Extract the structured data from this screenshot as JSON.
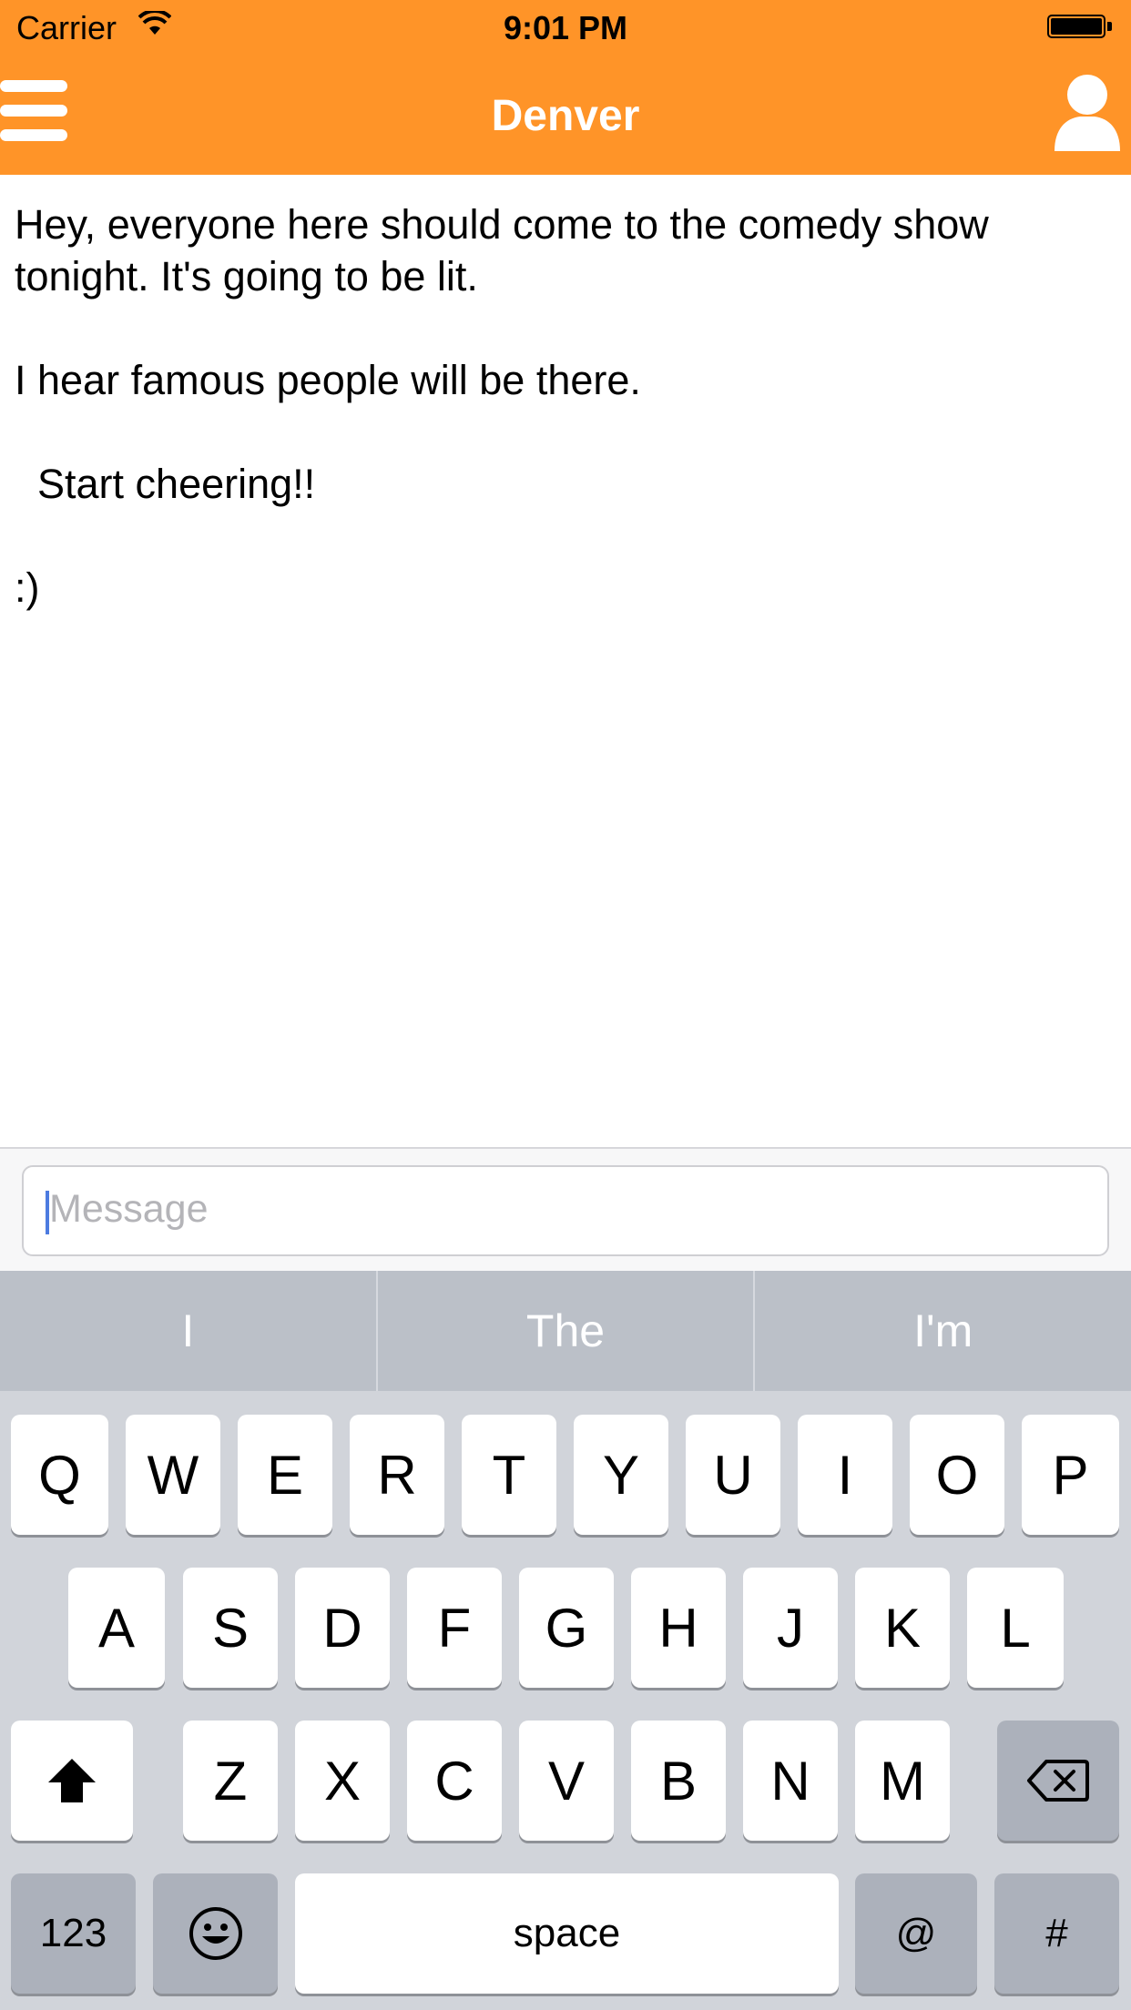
{
  "status_bar": {
    "carrier": "Carrier",
    "time": "9:01 PM"
  },
  "nav": {
    "title": "Denver",
    "accent_color": "#FF9428",
    "menu_icon": "hamburger-menu-icon",
    "profile_icon": "person-icon"
  },
  "messages": [
    "Hey, everyone here should come to the comedy show tonight. It's going to be lit.",
    "I hear famous people will be there.",
    "  Start cheering!!",
    ":)"
  ],
  "composer": {
    "placeholder": "Message"
  },
  "predictions": [
    "I",
    "The",
    "I'm"
  ],
  "keyboard": {
    "row1": [
      "Q",
      "W",
      "E",
      "R",
      "T",
      "Y",
      "U",
      "I",
      "O",
      "P"
    ],
    "row2": [
      "A",
      "S",
      "D",
      "F",
      "G",
      "H",
      "J",
      "K",
      "L"
    ],
    "row3": [
      "Z",
      "X",
      "C",
      "V",
      "B",
      "N",
      "M"
    ],
    "numbers_label": "123",
    "space_label": "space",
    "at_label": "@",
    "hash_label": "#",
    "shift_icon": "shift-icon",
    "backspace_icon": "backspace-icon",
    "emoji_icon": "emoji-icon"
  }
}
